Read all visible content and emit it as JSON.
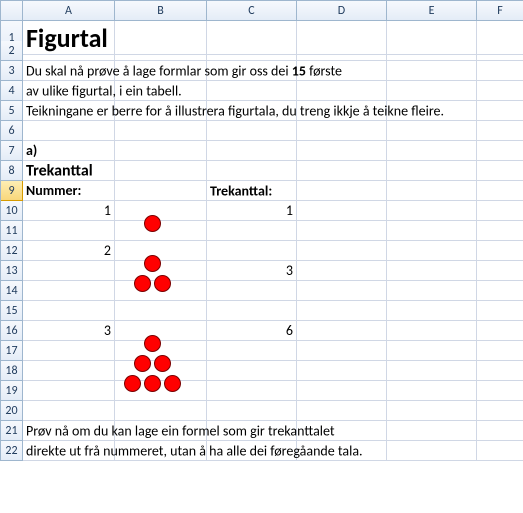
{
  "columns": [
    "A",
    "B",
    "C",
    "D",
    "E",
    "F"
  ],
  "rows": [
    "1",
    "2",
    "3",
    "4",
    "5",
    "6",
    "7",
    "8",
    "9",
    "10",
    "11",
    "12",
    "13",
    "14",
    "15",
    "16",
    "17",
    "18",
    "19",
    "20",
    "21",
    "22"
  ],
  "selected_row": "9",
  "title": "Figurtal",
  "line3_pre": "Du skal nå prøve å lage formlar som gir oss dei ",
  "line3_bold": "15",
  "line3_post": " første",
  "line4": "av ulike figurtal, i ein tabell.",
  "line5": "Teikningane er berre for å illustrera figurtala, du treng ikkje å teikne fleire.",
  "a7": "a)",
  "a8": "Trekanttal",
  "a9": "Nummer:",
  "c9": "Trekanttal:",
  "nums": {
    "n1": "1",
    "n2": "2",
    "n3": "3"
  },
  "vals": {
    "v1": "1",
    "v2": "3",
    "v3": "6"
  },
  "line21": "Prøv nå om du kan lage ein  formel som gir trekanttalet",
  "line22": "direkte ut frå nummeret, utan å ha alle dei føregåande tala."
}
